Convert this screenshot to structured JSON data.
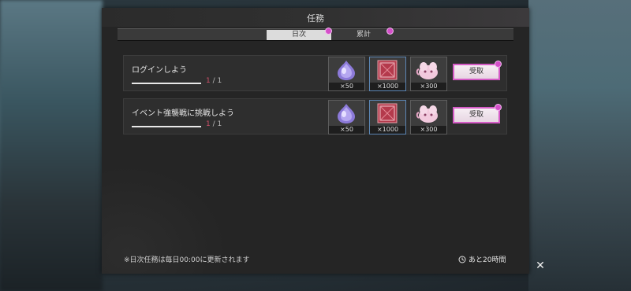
{
  "window": {
    "title": "任務"
  },
  "tabs": [
    {
      "label": "日次",
      "badge": true
    },
    {
      "label": "累計",
      "badge": true
    }
  ],
  "missions": [
    {
      "title": "ログインしよう",
      "progress_current": "1",
      "progress_sep": " / ",
      "progress_total": "1",
      "rewards": [
        {
          "icon": "purple-crystal-icon",
          "qty": "×50"
        },
        {
          "icon": "red-ticket-box-icon",
          "qty": "×1000"
        },
        {
          "icon": "pink-spirit-icon",
          "qty": "×300"
        }
      ],
      "claim_label": "受取"
    },
    {
      "title": "イベント強襲戦に挑戦しよう",
      "progress_current": "1",
      "progress_sep": " / ",
      "progress_total": "1",
      "rewards": [
        {
          "icon": "purple-crystal-icon",
          "qty": "×50"
        },
        {
          "icon": "red-ticket-box-icon",
          "qty": "×1000"
        },
        {
          "icon": "pink-spirit-icon",
          "qty": "×300"
        }
      ],
      "claim_label": "受取"
    }
  ],
  "footer": {
    "note": "※日次任務は毎日00:00に更新されます",
    "timer": "あと20時間"
  },
  "colors": {
    "accent_pink": "#d44fc9",
    "progress_current": "#d0506a"
  }
}
